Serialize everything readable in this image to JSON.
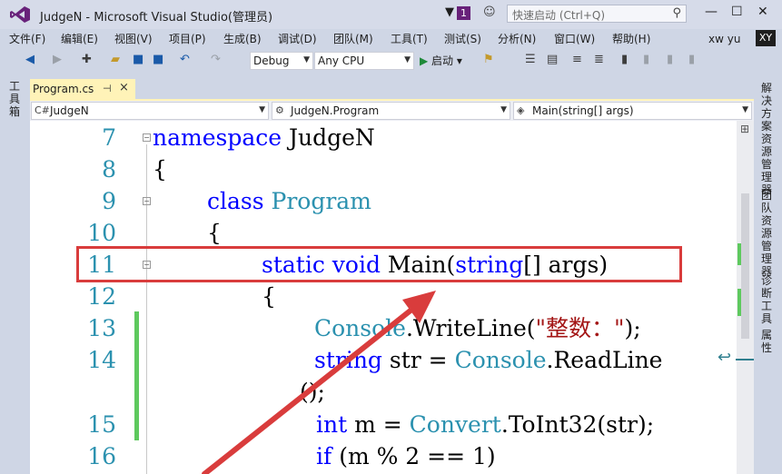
{
  "window": {
    "title": "JudgeN - Microsoft Visual Studio(管理员)",
    "notification_count": "1"
  },
  "quick_launch": {
    "placeholder": "快速启动 (Ctrl+Q)"
  },
  "menu": [
    "文件(F)",
    "编辑(E)",
    "视图(V)",
    "项目(P)",
    "生成(B)",
    "调试(D)",
    "团队(M)",
    "工具(T)",
    "测试(S)",
    "分析(N)",
    "窗口(W)",
    "帮助(H)"
  ],
  "user": {
    "name": "xw yu",
    "initials": "XY"
  },
  "toolbar": {
    "config": "Debug",
    "platform": "Any CPU",
    "start_label": "启动"
  },
  "left_rail": {
    "label": "工具箱"
  },
  "right_rail": [
    "解决方案资源管理器",
    "团队资源管理器",
    "诊断工具",
    "属性"
  ],
  "tab": {
    "label": "Program.cs",
    "pin": "⊣",
    "close": "×"
  },
  "nav": {
    "project": "JudgeN",
    "class": "JudgeN.Program",
    "member": "Main(string[] args)"
  },
  "code": {
    "line_numbers": [
      "7",
      "8",
      "9",
      "10",
      "11",
      "12",
      "13",
      "14",
      "15",
      "16"
    ],
    "l7_kw": "namespace",
    "l7_name": " JudgeN",
    "l8": "{",
    "l9_kw": "class",
    "l9_type": " Program",
    "l10": "{",
    "l11_kw1": "static",
    "l11_kw2": " void",
    "l11_rest1": " Main(",
    "l11_kw3": "string",
    "l11_rest2": "[] args)",
    "l12": "{",
    "l13_type": "Console",
    "l13_rest1": ".WriteLine(",
    "l13_str": "\"整数：\"",
    "l13_rest2": ");",
    "l14_kw": "string",
    "l14_rest1": " str = ",
    "l14_type": "Console",
    "l14_rest2": ".ReadLine",
    "l14_cont": "();",
    "l15_kw": "int",
    "l15_rest1": " m = ",
    "l15_type": "Convert",
    "l15_rest2": ".ToInt32(str);",
    "l16_kw": "if",
    "l16_rest": " (m % 2 == 1)"
  },
  "annotation_color": "#d93c3c"
}
